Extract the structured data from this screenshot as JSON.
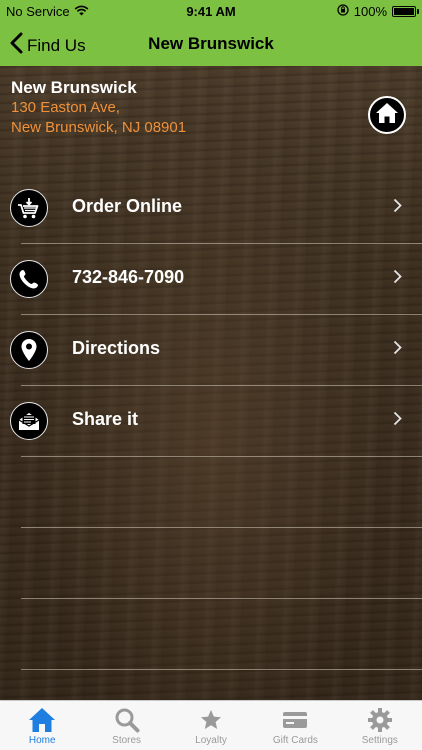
{
  "status_bar": {
    "carrier": "No Service",
    "time": "9:41 AM",
    "battery": "100%"
  },
  "nav": {
    "back_label": "Find Us",
    "title": "New Brunswick"
  },
  "store": {
    "name": "New Brunswick",
    "address_line1": "130 Easton Ave,",
    "address_line2": "New Brunswick, NJ 08901"
  },
  "actions": [
    {
      "label": "Order Online",
      "icon": "cart-icon"
    },
    {
      "label": "732-846-7090",
      "icon": "phone-icon"
    },
    {
      "label": "Directions",
      "icon": "location-pin-icon"
    },
    {
      "label": "Share it",
      "icon": "mail-icon"
    }
  ],
  "tabs": [
    {
      "label": "Home",
      "icon": "home-icon",
      "active": true
    },
    {
      "label": "Stores",
      "icon": "search-icon",
      "active": false
    },
    {
      "label": "Loyalty",
      "icon": "star-icon",
      "active": false
    },
    {
      "label": "Gift Cards",
      "icon": "card-icon",
      "active": false
    },
    {
      "label": "Settings",
      "icon": "gear-icon",
      "active": false
    }
  ],
  "colors": {
    "header_green": "#7dc142",
    "address_orange": "#f0913a",
    "tab_active_blue": "#1e7fe0",
    "tab_inactive_gray": "#9a9a9a"
  }
}
